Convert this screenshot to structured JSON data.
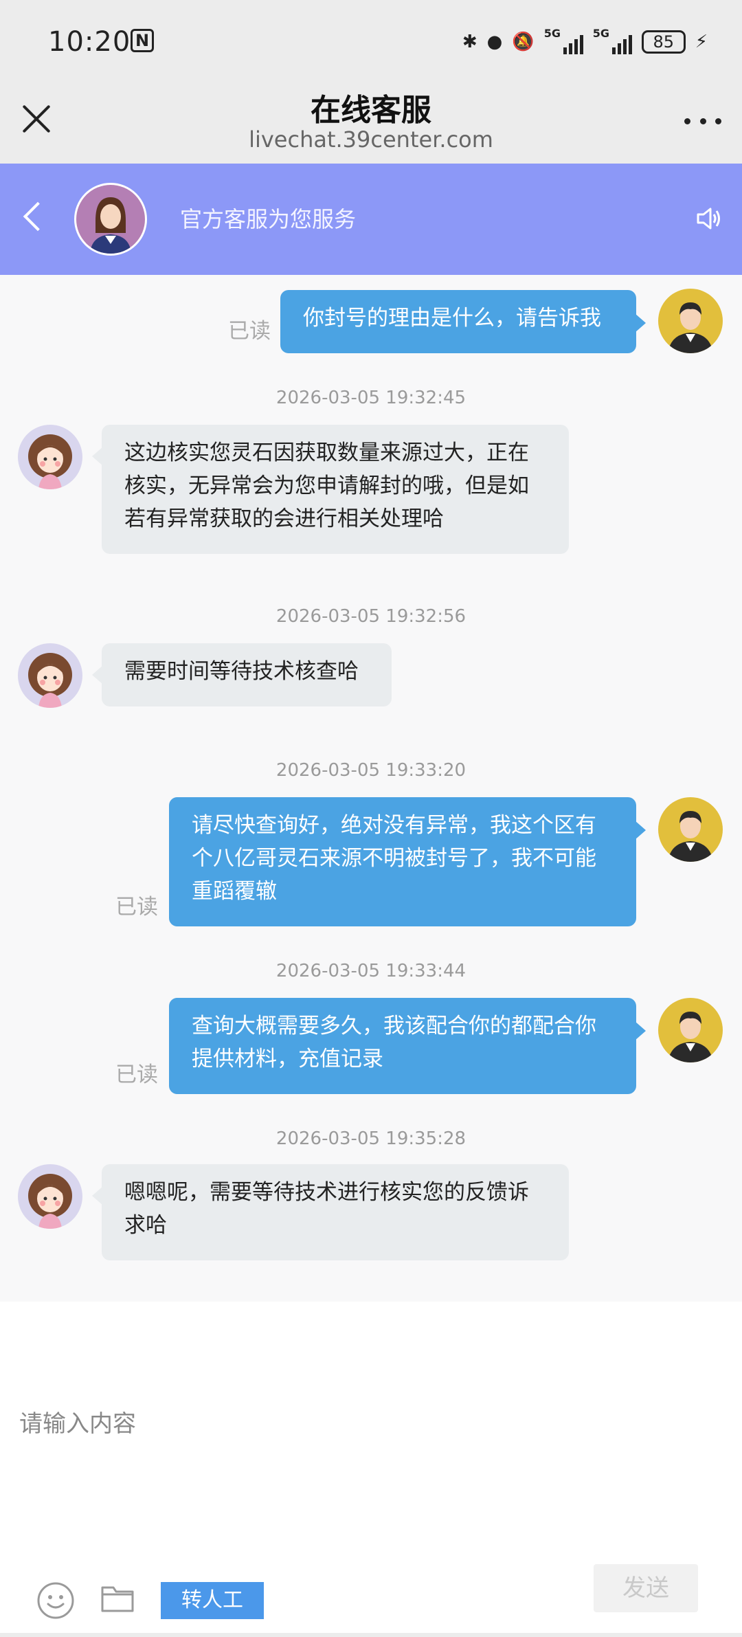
{
  "status_bar": {
    "time": "10:20",
    "nfc": "N",
    "bluetooth": "✱",
    "location": "●",
    "mute": "🔕",
    "sim1": "5G",
    "sim2": "5G",
    "battery": "85",
    "charging": "⚡"
  },
  "header": {
    "title": "在线客服",
    "url": "livechat.39center.com"
  },
  "banner": {
    "text": "官方客服为您服务",
    "color": "#8c98f7"
  },
  "messages": [
    {
      "side": "out",
      "text": "你封号的理由是什么，请告诉我",
      "read": "已读"
    },
    {
      "timestamp": "2026-03-05 19:32:45",
      "side": "in",
      "lines": [
        "这边核实您灵石因获取数量来源过大，正在",
        "核实，无异常会为您申请解封的哦，但是如",
        "若有异常获取的会进行相关处理哈"
      ]
    },
    {
      "timestamp": "2026-03-05 19:32:56",
      "side": "in",
      "text": "需要时间等待技术核查哈"
    },
    {
      "timestamp": "2026-03-05 19:33:20",
      "side": "out",
      "lines": [
        "请尽快查询好，绝对没有异常，我这个区有",
        "个八亿哥灵石来源不明被封号了，我不可能",
        "重蹈覆辙"
      ],
      "read": "已读"
    },
    {
      "timestamp": "2026-03-05 19:33:44",
      "side": "out",
      "lines": [
        "查询大概需要多久，我该配合你的都配合你",
        "提供材料，充值记录"
      ],
      "read": "已读"
    },
    {
      "timestamp": "2026-03-05 19:35:28",
      "side": "in",
      "lines": [
        "嗯嗯呢，需要等待技术进行核实您的反馈诉",
        "求哈"
      ]
    }
  ],
  "input": {
    "placeholder": "请输入内容",
    "transfer_label": "转人工",
    "send_label": "发送"
  },
  "colors": {
    "outgoing_bubble": "#4ba3e3",
    "incoming_bubble": "#e9ecee",
    "transfer_button": "#4b98ea"
  }
}
